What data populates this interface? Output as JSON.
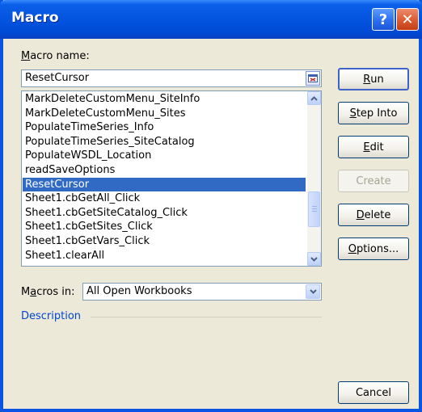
{
  "window": {
    "title": "Macro"
  },
  "title_buttons": {
    "help": "?",
    "close": "✕"
  },
  "macro_name": {
    "label": "Macro name:",
    "mnemonic": "M",
    "label_rest": "acro name:",
    "value": "ResetCursor"
  },
  "macro_list": {
    "items": [
      {
        "name": "MarkDeleteCustomMenu_SiteInfo",
        "selected": false
      },
      {
        "name": "MarkDeleteCustomMenu_Sites",
        "selected": false
      },
      {
        "name": "PopulateTimeSeries_Info",
        "selected": false
      },
      {
        "name": "PopulateTimeSeries_SiteCatalog",
        "selected": false
      },
      {
        "name": "PopulateWSDL_Location",
        "selected": false
      },
      {
        "name": "readSaveOptions",
        "selected": false
      },
      {
        "name": "ResetCursor",
        "selected": true
      },
      {
        "name": "Sheet1.cbGetAll_Click",
        "selected": false
      },
      {
        "name": "Sheet1.cbGetSiteCatalog_Click",
        "selected": false
      },
      {
        "name": "Sheet1.cbGetSites_Click",
        "selected": false
      },
      {
        "name": "Sheet1.cbGetVars_Click",
        "selected": false
      },
      {
        "name": "Sheet1.clearAll",
        "selected": false
      }
    ],
    "scroll_icons": {
      "up": "chevron-up-icon",
      "down": "chevron-down-icon"
    }
  },
  "buttons": {
    "run": {
      "mn": "R",
      "rest": "un"
    },
    "step_into": {
      "mn": "S",
      "rest": "tep Into"
    },
    "edit": {
      "mn": "E",
      "rest": "dit"
    },
    "create": {
      "label": "Create",
      "disabled": true
    },
    "delete": {
      "mn": "D",
      "rest": "elete"
    },
    "options": {
      "mn": "O",
      "rest": "ptions..."
    },
    "cancel": {
      "label": "Cancel"
    }
  },
  "macros_in": {
    "label_mn": "M",
    "label_pre": "",
    "label_a": "a",
    "label_rest": "cros in:",
    "value": "All Open Workbooks"
  },
  "description": {
    "label": "Description"
  },
  "colors": {
    "title_blue": "#0a55e2",
    "selection": "#316ac5",
    "dialog_bg": "#ece9d8",
    "description_blue": "#0046d5"
  }
}
